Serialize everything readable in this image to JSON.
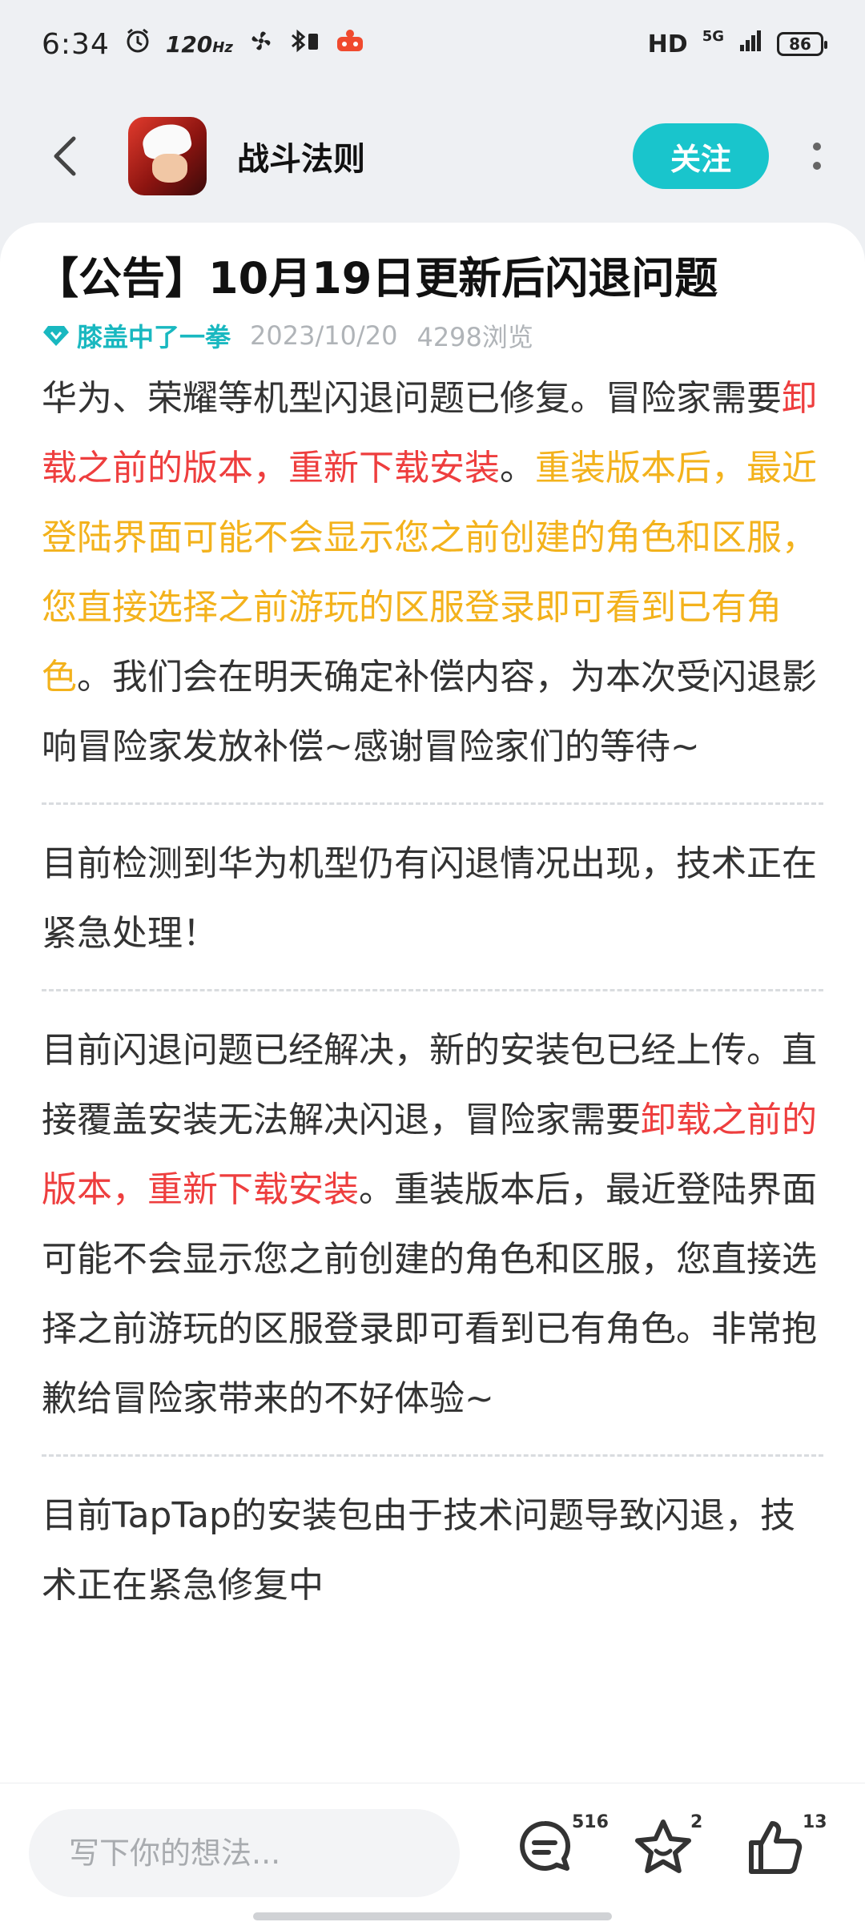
{
  "status_bar": {
    "time": "6:34",
    "refresh_rate": "120",
    "refresh_unit": "Hz",
    "network": "HD",
    "network_gen": "5G",
    "battery": "86"
  },
  "header": {
    "app_name": "战斗法则",
    "follow_label": "关注"
  },
  "post": {
    "title": "【公告】10月19日更新后闪退问题",
    "author": "膝盖中了一拳",
    "date": "2023/10/20",
    "views": "4298浏览",
    "p1": {
      "a": "华为、荣耀等机型闪退问题已修复。冒险家需要",
      "red": "卸载之前的版本，重新下载安装",
      "b": "。",
      "orange": "重装版本后，最近登陆界面可能不会显示您之前创建的角色和区服，您直接选择之前游玩的区服登录即可看到已有角色",
      "c": "。我们会在明天确定补偿内容，为本次受闪退影响冒险家发放补偿~感谢冒险家们的等待~"
    },
    "p2": "目前检测到华为机型仍有闪退情况出现，技术正在紧急处理！",
    "p3": {
      "a": "目前闪退问题已经解决，新的安装包已经上传。直接覆盖安装无法解决闪退，冒险家需要",
      "red": "卸载之前的版本，重新下载安装",
      "b": "。重装版本后，最近登陆界面可能不会显示您之前创建的角色和区服，您直接选择之前游玩的区服登录即可看到已有角色。非常抱歉给冒险家带来的不好体验~"
    },
    "p4": "目前TapTap的安装包由于技术问题导致闪退，技术正在紧急修复中"
  },
  "bottom_bar": {
    "comment_placeholder": "写下你的想法...",
    "comments_count": "516",
    "favorites_count": "2",
    "likes_count": "13"
  },
  "colors": {
    "accent": "#19c5cc",
    "highlight_red": "#ee3e3e",
    "highlight_orange": "#f3b21c"
  },
  "icons": [
    "back-arrow-icon",
    "diamond-icon",
    "more-vert-icon",
    "comment-icon",
    "star-icon",
    "thumbs-up-icon"
  ]
}
